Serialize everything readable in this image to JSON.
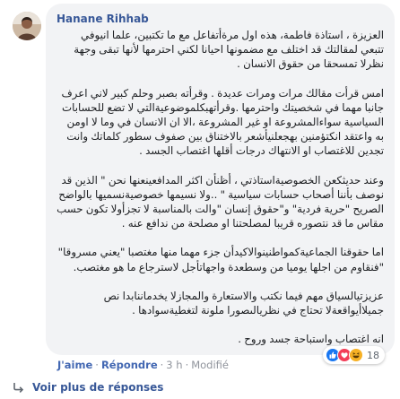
{
  "comment": {
    "author": "Hanane Rihhab",
    "paragraphs": [
      "العزيزة ، استاذة فاطمة، هذه اول مرةأتفاعل مع ما تكتبين، علما انيوفي تتبعي لمقالتك قد اختلف مع مضمونها احيانا لكني احترمها لأنها تبقى وجهة نظرلا تمسحقا من حقوق الانسان .",
      "امس قرأت مقالك مرات ومرات عديدة . وقرأته بصبر وحلم كبير لاني اعرف جانبا مهما في شخصيتك واحترمها .وقرأتهبكلموضوعيةالتي لا تضع للحسابات السياسية سواءالمشروعة او غير المشروعة ،الا ان الانسان في وما لا اومن به واعتقد انكتؤمنين بهجعلنيأشعر بالاختناق بين صفوف سطور كلماتك وانت تجدين للاغتصاب او الانتهاك درجات أقلها اغتصاب الجسد .",
      "وعند حديثكعن الخصوصيةاستاذتي ، أظنأن اكثر المدافعينعنها نحن \" الذين قد نوصف بأننا أصحاب حسابات سياسية \" ..ولا نسيمها خصوصيةنسميها بالواضح الصريح \"حرية فردية\" و\"حقوق إنسان \"والت بالمناسبة لا تجزأولا تكون حسب مقاس ما قد نتصوره قريبا لمصلحتنا او مصلحة من ندافع عنه .",
      "اما حقوقنا الجماعيةكمواطنينوالاكيدأن جزء مهما منها مغتصبا \"يعني مسروقا\" \"فنقاوم من اجلها يوميا من وسطعدة واجهاتأجل لاسترجاع ما هو مغتصب.",
      "عزيزتيالسياق مهم فيما نكتب والاستعارة والمجازلا يخدماننابدا نص جميلاأيواقعةلا تحتاج في نظريالىصورا ملونة لتغطيةسوادها .",
      "انه اغتصاب واستباحة جسد وروح ."
    ],
    "actions": {
      "like": "J'aime",
      "reply": "Répondre",
      "time": "3 h",
      "modified": "Modifié",
      "separator": "·"
    },
    "reactions": {
      "icons": [
        "like",
        "love",
        "haha"
      ],
      "count": "18",
      "colors": {
        "like": "#1877f2",
        "love": "#f33e58",
        "haha": "#f7b125"
      }
    }
  },
  "more_replies": {
    "label": "Voir plus de réponses",
    "icon": "reply-arrow-icon"
  }
}
